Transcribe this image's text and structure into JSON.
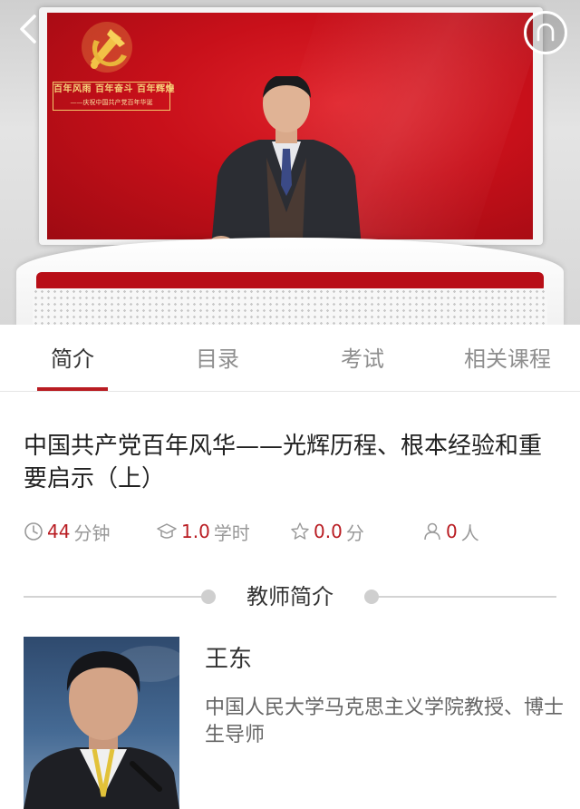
{
  "video": {
    "banner_line1": "百年风雨 百年奋斗 百年辉煌",
    "banner_line2": "——庆祝中国共产党百年华诞",
    "back_icon": "chevron-left-icon",
    "tool_icon": "headset-icon"
  },
  "tabs": [
    {
      "label": "简介",
      "active": true
    },
    {
      "label": "目录",
      "active": false
    },
    {
      "label": "考试",
      "active": false
    },
    {
      "label": "相关课程",
      "active": false
    }
  ],
  "course": {
    "title": "中国共产党百年风华——光辉历程、根本经验和重要启示（上）",
    "duration_value": "44",
    "duration_unit": "分钟",
    "hours_value": "1.0",
    "hours_unit": "学时",
    "score_value": "0.0",
    "score_unit": "分",
    "people_value": "0",
    "people_unit": "人"
  },
  "teacher_section": {
    "heading": "教师简介",
    "name": "王东",
    "description": "中国人民大学马克思主义学院教授、博士生导师"
  },
  "colors": {
    "accent": "#b91c22",
    "muted_text": "#999999",
    "divider": "#d3d3d3"
  }
}
